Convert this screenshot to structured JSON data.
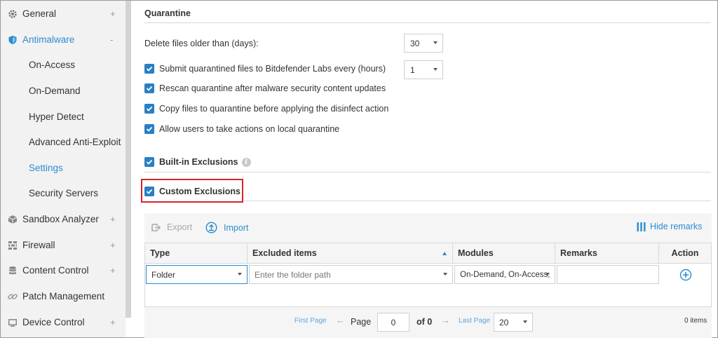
{
  "sidebar": {
    "items": [
      {
        "label": "General",
        "icon": "gear-icon",
        "expander": "+"
      },
      {
        "label": "Antimalware",
        "icon": "shield-icon",
        "expander": "-"
      },
      {
        "label": "On-Access"
      },
      {
        "label": "On-Demand"
      },
      {
        "label": "Hyper Detect"
      },
      {
        "label": "Advanced Anti-Exploit"
      },
      {
        "label": "Settings"
      },
      {
        "label": "Security Servers"
      },
      {
        "label": "Sandbox Analyzer",
        "icon": "cube-icon",
        "expander": "+"
      },
      {
        "label": "Firewall",
        "icon": "firewall-icon",
        "expander": "+"
      },
      {
        "label": "Content Control",
        "icon": "database-icon",
        "expander": "+"
      },
      {
        "label": "Patch Management",
        "icon": "link-icon"
      },
      {
        "label": "Device Control",
        "icon": "device-icon",
        "expander": "+"
      }
    ],
    "active_item": "Settings"
  },
  "quarantine": {
    "title": "Quarantine",
    "delete_label": "Delete files older than (days):",
    "delete_value": "30",
    "submit_label": "Submit quarantined files to Bitdefender Labs every (hours)",
    "submit_value": "1",
    "rescan_label": "Rescan quarantine after malware security content updates",
    "copy_label": "Copy files to quarantine before applying the disinfect action",
    "allow_label": "Allow users to take actions on local quarantine"
  },
  "exclusions": {
    "builtin_label": "Built-in Exclusions",
    "custom_label": "Custom Exclusions",
    "export_label": "Export",
    "import_label": "Import",
    "hide_remarks_label": "Hide remarks",
    "columns": [
      "Type",
      "Excluded items",
      "Modules",
      "Remarks",
      "Action"
    ],
    "row": {
      "type_value": "Folder",
      "path_placeholder": "Enter the folder path",
      "modules_value": "On-Demand, On-Access,"
    }
  },
  "pager": {
    "first_page": "First Page",
    "page_label": "Page",
    "page_value": "0",
    "of_label": "of 0",
    "last_page": "Last Page",
    "per_page": "20",
    "items_count": "0 items"
  },
  "colors": {
    "accent": "#2a8cd1",
    "checkbox": "#2a7fc4",
    "highlight_box": "#d9232a"
  }
}
